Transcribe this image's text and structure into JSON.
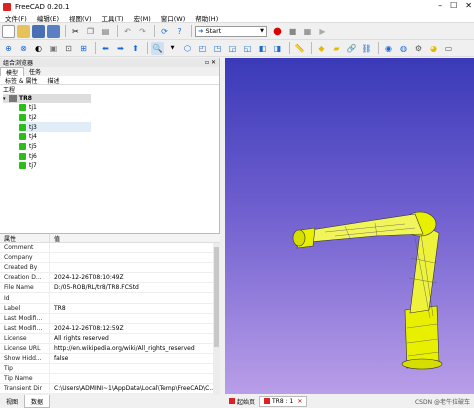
{
  "window": {
    "title": "FreeCAD 0.20.1"
  },
  "menu": [
    "文件(F)",
    "编辑(E)",
    "视图(V)",
    "工具(T)",
    "宏(M)",
    "窗口(W)",
    "帮助(H)"
  ],
  "toolbar": {
    "workbench_value": "Start"
  },
  "combo_view": {
    "title": "组合浏览器",
    "tabs": [
      "模型",
      "任务"
    ],
    "subtabs": [
      "标签 & 属性",
      "描述"
    ],
    "tree_section": "工程",
    "document": "TR8",
    "items": [
      "tj1",
      "tj2",
      "tj3",
      "tj4",
      "tj5",
      "tj6",
      "tj7"
    ]
  },
  "properties": {
    "header_name": "属性",
    "header_value": "值",
    "rows": [
      {
        "name": "Comment",
        "value": ""
      },
      {
        "name": "Company",
        "value": ""
      },
      {
        "name": "Created By",
        "value": ""
      },
      {
        "name": "Creation D...",
        "value": "2024-12-26T08:10:49Z"
      },
      {
        "name": "File Name",
        "value": "D:/05-ROB/RL/tr8/TR8.FCStd"
      },
      {
        "name": "Id",
        "value": ""
      },
      {
        "name": "Label",
        "value": "TR8"
      },
      {
        "name": "Last Modifi...",
        "value": ""
      },
      {
        "name": "Last Modifi...",
        "value": "2024-12-26T08:12:59Z"
      },
      {
        "name": "License",
        "value": "All rights reserved"
      },
      {
        "name": "License URL",
        "value": "http://en.wikipedia.org/wiki/All_rights_reserved"
      },
      {
        "name": "Show Hidd...",
        "value": "false"
      },
      {
        "name": "Tip",
        "value": ""
      },
      {
        "name": "Tip Name",
        "value": ""
      },
      {
        "name": "Transient Dir",
        "value": "C:\\Users\\ADMINI~1\\AppData\\Local\\Temp\\FreeCAD\\C..."
      }
    ]
  },
  "bottom_tabs": [
    "视图",
    "数据"
  ],
  "doc_tabs": [
    "起始页",
    "TR8 : 1"
  ],
  "watermark": "CSDN @老牛拉破车",
  "colors": {
    "viewport_top": "#3a3ab8",
    "viewport_bottom": "#b99ee8",
    "robot_highlight": "#e8f000",
    "tree_icon": "#2cbd1c"
  }
}
